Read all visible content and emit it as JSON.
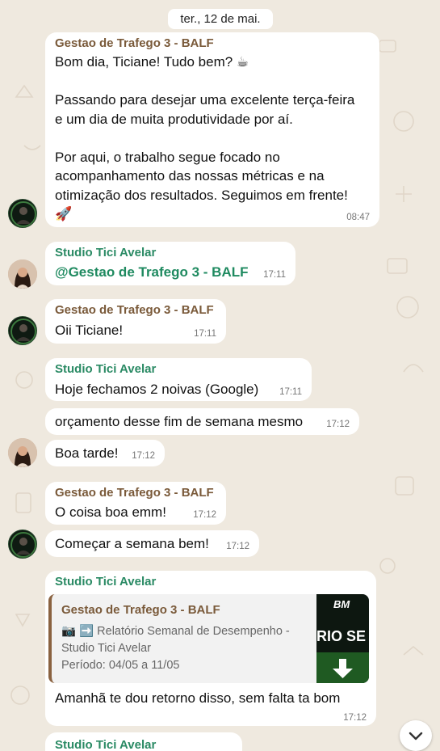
{
  "date_separator": "ter., 12 de mai.",
  "senders": {
    "balf": "Gestao de Trafego 3 - BALF",
    "tici": "Studio Tici Avelar"
  },
  "messages": {
    "m1": {
      "line1": "Bom dia, Ticiane! Tudo bem? ☕",
      "line2": "Passando para desejar uma excelente terça-feira",
      "line3": "e um dia de muita produtividade por aí.",
      "line4": "Por aqui, o trabalho segue focado no",
      "line5": "acompanhamento das nossas métricas e na",
      "line6": "otimização dos resultados. Seguimos em frente!",
      "line7": "🚀",
      "time": "08:47"
    },
    "m2": {
      "mention": "@Gestao de Trafego 3 - BALF",
      "time": "17:11"
    },
    "m3": {
      "text": "Oii Ticiane!",
      "time": "17:11"
    },
    "m4": {
      "text": "Hoje fechamos 2 noivas (Google)",
      "time": "17:11"
    },
    "m5": {
      "text": "orçamento desse fim de semana mesmo",
      "time": "17:12"
    },
    "m6": {
      "text": "Boa tarde!",
      "time": "17:12"
    },
    "m7": {
      "text": "O coisa boa emm!",
      "time": "17:12"
    },
    "m8": {
      "text": "Começar a semana bem!",
      "time": "17:12"
    },
    "m9": {
      "quote_line1": "📷 ➡️ Relatório Semanal de Desempenho -",
      "quote_line2": "Studio Tici Avelar",
      "quote_line3": "Período: 04/05 a 11/05",
      "thumb_logo": "BM",
      "thumb_text": "RIO SE",
      "text": "Amanhã te dou retorno disso, sem falta ta bom",
      "time": "17:12"
    }
  },
  "colors": {
    "wallpaper": "#efe9df",
    "bubble": "#ffffff",
    "balf_name": "#7a5a3a",
    "tici_name": "#2a8a64",
    "quote_bar": "#8a6240"
  },
  "icons": {
    "scroll_down": "chevron-down-icon",
    "camera": "camera-icon",
    "arrow": "right-arrow-icon"
  }
}
